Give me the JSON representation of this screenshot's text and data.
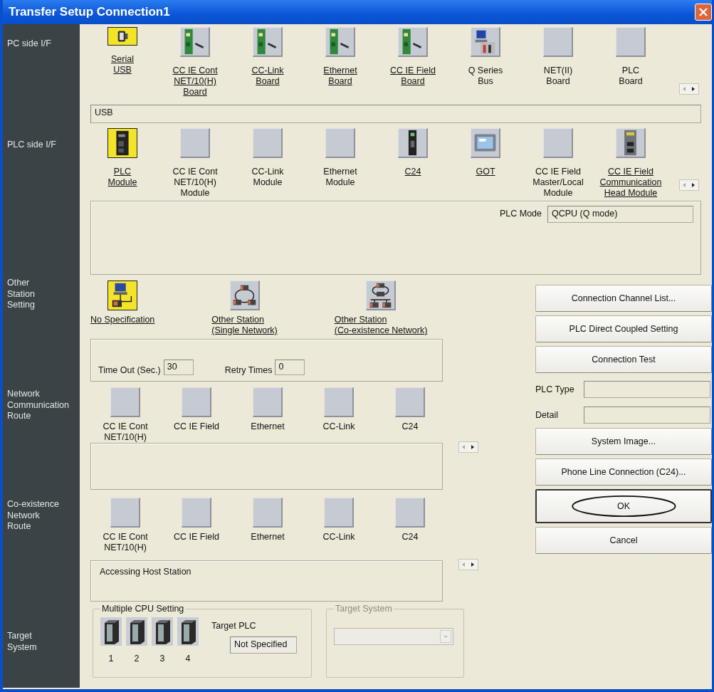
{
  "window": {
    "title": "Transfer Setup Connection1"
  },
  "pc_side": {
    "label": "PC side I/F",
    "items": [
      {
        "label": "Serial\nUSB",
        "kind": "usb",
        "selected": true,
        "linked": true
      },
      {
        "label": "CC IE Cont\nNET/10(H)\nBoard",
        "kind": "board",
        "selected": false,
        "linked": true
      },
      {
        "label": "CC-Link\nBoard",
        "kind": "board",
        "selected": false,
        "linked": true
      },
      {
        "label": "Ethernet\nBoard",
        "kind": "board",
        "selected": false,
        "linked": true
      },
      {
        "label": "CC IE Field\nBoard",
        "kind": "board",
        "selected": false,
        "linked": true
      },
      {
        "label": "Q Series\nBus",
        "kind": "bus",
        "selected": false,
        "linked": false
      },
      {
        "label": "NET(II)\nBoard",
        "kind": "blank",
        "selected": false,
        "linked": false
      },
      {
        "label": "PLC\nBoard",
        "kind": "blank",
        "selected": false,
        "linked": false
      }
    ],
    "field": {
      "value": "USB"
    }
  },
  "plc_side": {
    "label": "PLC side I/F",
    "items": [
      {
        "label": "PLC\nModule",
        "kind": "plc",
        "selected": true,
        "linked": true
      },
      {
        "label": "CC IE Cont\nNET/10(H)\nModule",
        "kind": "blank",
        "selected": false,
        "linked": false
      },
      {
        "label": "CC-Link\nModule",
        "kind": "blank",
        "selected": false,
        "linked": false
      },
      {
        "label": "Ethernet\nModule",
        "kind": "blank",
        "selected": false,
        "linked": false
      },
      {
        "label": "C24",
        "kind": "c24",
        "selected": false,
        "linked": true
      },
      {
        "label": "GOT",
        "kind": "got",
        "selected": false,
        "linked": true
      },
      {
        "label": "CC IE Field\nMaster/Local\nModule",
        "kind": "blank",
        "selected": false,
        "linked": false
      },
      {
        "label": "CC IE Field\nCommunication\nHead Module",
        "kind": "head",
        "selected": false,
        "linked": true
      }
    ],
    "plc_mode": {
      "label": "PLC Mode",
      "value": "QCPU (Q mode)"
    }
  },
  "other_station": {
    "label": "Other\nStation\nSetting",
    "items": [
      {
        "label": "No Specification",
        "kind": "pc",
        "selected": true,
        "linked": true
      },
      {
        "label": "Other Station\n(Single Network)",
        "kind": "network",
        "selected": false,
        "linked": true
      },
      {
        "label": "Other Station\n(Co-existence Network)",
        "kind": "coexist",
        "selected": false,
        "linked": true
      }
    ],
    "timeout": {
      "label": "Time Out (Sec.)",
      "value": "30"
    },
    "retry": {
      "label": "Retry Times",
      "value": "0"
    }
  },
  "network_route": {
    "label": "Network\nCommunication\nRoute",
    "items": [
      {
        "label": "CC IE Cont\nNET/10(H)",
        "selected": false,
        "linked": false
      },
      {
        "label": "CC IE Field",
        "selected": false,
        "linked": false
      },
      {
        "label": "Ethernet",
        "selected": false,
        "linked": false
      },
      {
        "label": "CC-Link",
        "selected": false,
        "linked": false
      },
      {
        "label": "C24",
        "selected": false,
        "linked": false
      }
    ]
  },
  "coexistence_route": {
    "label": "Co-existence\nNetwork\nRoute",
    "items": [
      {
        "label": "CC IE Cont\nNET/10(H)",
        "selected": false,
        "linked": false
      },
      {
        "label": "CC IE Field",
        "selected": false,
        "linked": false
      },
      {
        "label": "Ethernet",
        "selected": false,
        "linked": false
      },
      {
        "label": "CC-Link",
        "selected": false,
        "linked": false
      },
      {
        "label": "C24",
        "selected": false,
        "linked": false
      }
    ],
    "panel_text": "Accessing Host Station"
  },
  "target_system": {
    "label": "Target\nSystem",
    "multiple_cpu": {
      "title": "Multiple CPU Setting",
      "cpus": [
        "1",
        "2",
        "3",
        "4"
      ],
      "target_plc_label": "Target PLC",
      "target_plc_value": "Not Specified"
    },
    "target_group": {
      "title": "Target System",
      "disabled": true
    }
  },
  "side_controls": [
    {
      "kind": "button",
      "label": "Connection Channel List..."
    },
    {
      "kind": "button",
      "label": "PLC Direct Coupled Setting"
    },
    {
      "kind": "button",
      "label": "Connection Test"
    },
    {
      "kind": "field",
      "label": "PLC Type"
    },
    {
      "kind": "field",
      "label": "Detail"
    },
    {
      "kind": "button",
      "label": "System Image..."
    },
    {
      "kind": "button",
      "label": "Phone Line Connection (C24)..."
    },
    {
      "kind": "button",
      "label": "OK",
      "circled": true
    },
    {
      "kind": "button",
      "label": "Cancel"
    }
  ]
}
